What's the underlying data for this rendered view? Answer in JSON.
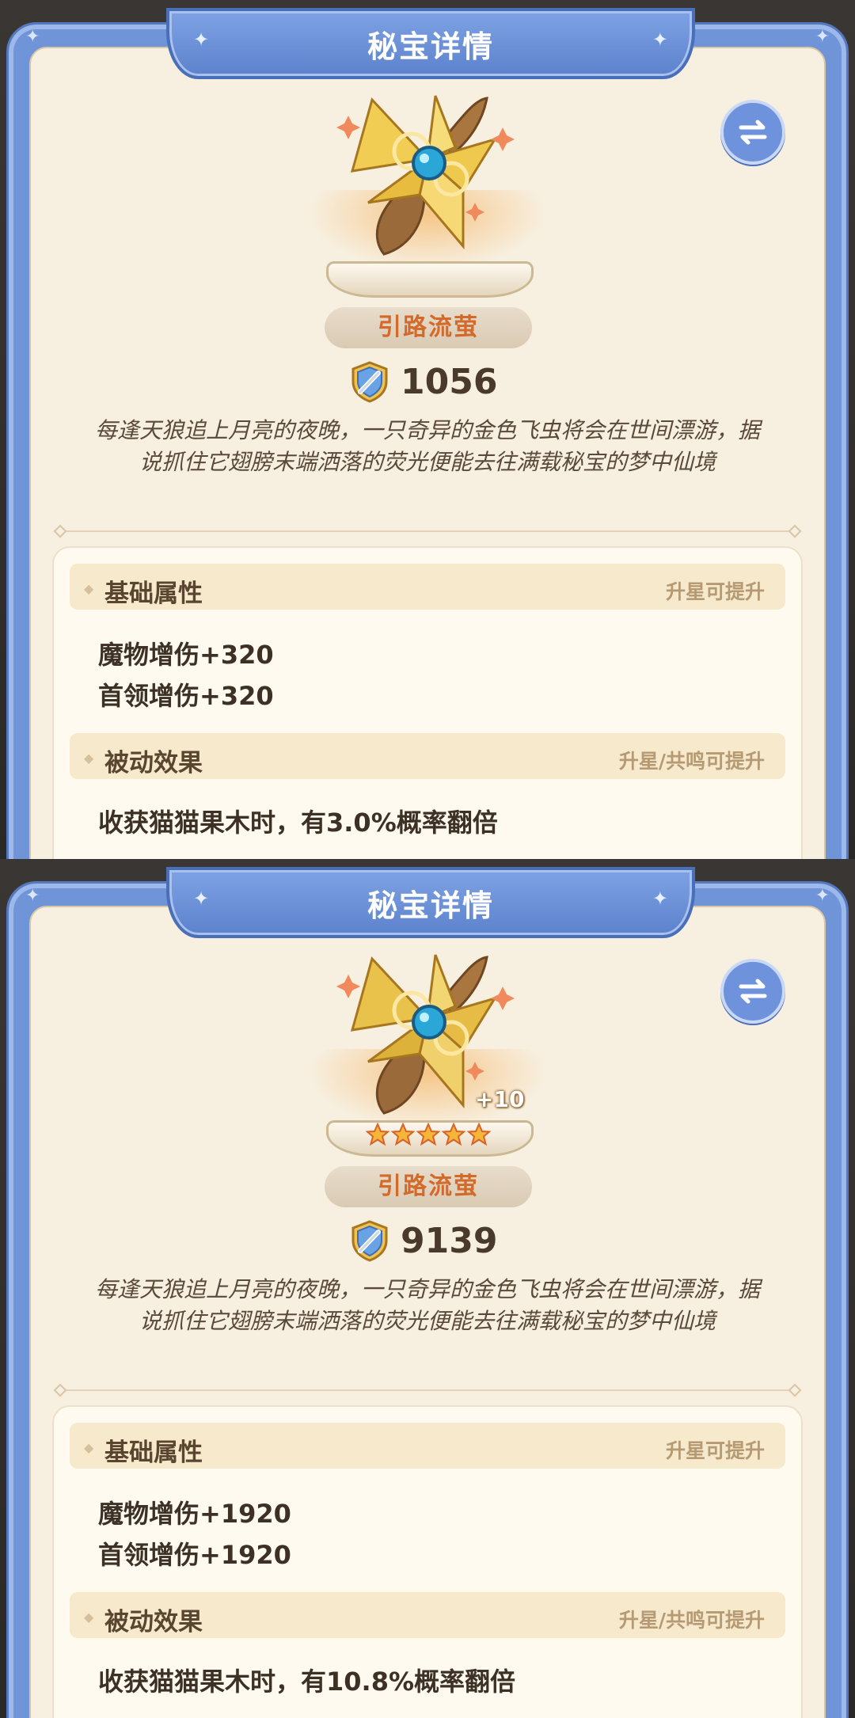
{
  "panels": [
    {
      "title": "秘宝详情",
      "item_name": "引路流萤",
      "power": "1056",
      "level_badge": "",
      "stars": 0,
      "description": "每逢天狼追上月亮的夜晚，一只奇异的金色飞虫将会在世间漂游，据说抓住它翅膀末端洒落的荧光便能去往满载秘宝的梦中仙境",
      "base_section": {
        "title": "基础属性",
        "hint": "升星可提升",
        "stats": [
          "魔物增伤+320",
          "首领增伤+320"
        ]
      },
      "passive_section": {
        "title": "被动效果",
        "hint": "升星/共鸣可提升",
        "effect": "收获猫猫果木时，有3.0%概率翻倍"
      }
    },
    {
      "title": "秘宝详情",
      "item_name": "引路流萤",
      "power": "9139",
      "level_badge": "+10",
      "stars": 5,
      "description": "每逢天狼追上月亮的夜晚，一只奇异的金色飞虫将会在世间漂游，据说抓住它翅膀末端洒落的荧光便能去往满载秘宝的梦中仙境",
      "base_section": {
        "title": "基础属性",
        "hint": "升星可提升",
        "stats": [
          "魔物增伤+1920",
          "首领增伤+1920"
        ]
      },
      "passive_section": {
        "title": "被动效果",
        "hint": "升星/共鸣可提升",
        "effect": "收获猫猫果木时，有10.8%概率翻倍"
      }
    }
  ],
  "colors": {
    "frame_blue": "#6f94d8",
    "parchment": "#f7efdf",
    "name_orange": "#d36a2a",
    "star_gold": "#f4b638"
  },
  "icons": [
    "swap-icon",
    "shield-sword-icon",
    "star-icon",
    "sparkle-icon",
    "firefly-artifact-icon"
  ]
}
